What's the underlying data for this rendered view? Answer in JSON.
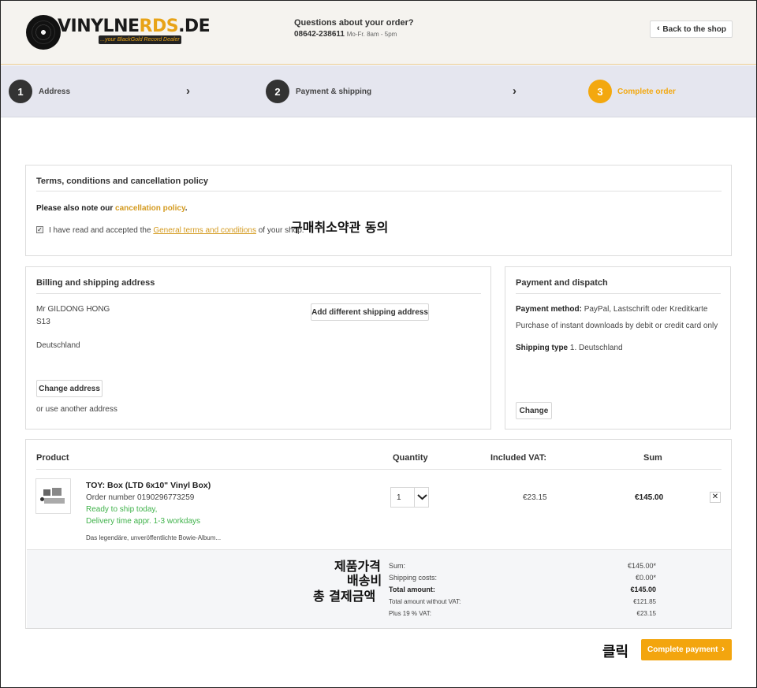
{
  "header": {
    "logo_text_a": "VINYLNE",
    "logo_text_b": "RDS",
    "logo_text_c": ".DE",
    "logo_tagline": "...your BlackGold Record Dealer",
    "question": "Questions about your order?",
    "phone": "08642-238611",
    "hours": "Mo-Fr. 8am - 5pm",
    "back_label": "Back to the shop"
  },
  "steps": [
    {
      "num": "1",
      "label": "Address"
    },
    {
      "num": "2",
      "label": "Payment & shipping"
    },
    {
      "num": "3",
      "label": "Complete order"
    }
  ],
  "terms": {
    "title": "Terms, conditions and cancellation policy",
    "note_prefix": "Please also note our",
    "note_link": "cancellation policy",
    "note_suffix": ".",
    "accept_prefix": "I have read and accepted the",
    "accept_link": "General terms and conditions",
    "accept_suffix": "of your shop.",
    "checked": true
  },
  "billing": {
    "title": "Billing and shipping address",
    "name": "Mr GILDONG HONG",
    "line2": "S13",
    "country": "Deutschland",
    "add_shipping_label": "Add different shipping address",
    "change_label": "Change address",
    "other_link": "or use another address"
  },
  "payment": {
    "title": "Payment and dispatch",
    "method_label": "Payment method:",
    "method_value": "PayPal, Lastschrift oder Kreditkarte",
    "method_note": "Purchase of instant downloads by debit or credit card only",
    "shipping_label": "Shipping type",
    "shipping_value": "1. Deutschland",
    "change_label": "Change"
  },
  "table": {
    "headers": {
      "product": "Product",
      "quantity": "Quantity",
      "vat": "Included VAT:",
      "sum": "Sum"
    },
    "items": [
      {
        "name": "TOY: Box (LTD 6x10\" Vinyl Box)",
        "order_number": "Order number 0190296773259",
        "status1": "Ready to ship today,",
        "status2": "Delivery time appr. 1-3 workdays",
        "description": "Das legendäre, unveröffentlichte Bowie-Album...",
        "quantity": "1",
        "vat": "€23.15",
        "sum": "€145.00",
        "remove": "✕"
      }
    ]
  },
  "summary": {
    "rows": [
      {
        "label": "Sum:",
        "value": "€145.00*"
      },
      {
        "label": "Shipping costs:",
        "value": "€0.00*"
      },
      {
        "label": "Total amount:",
        "value": "€145.00"
      },
      {
        "label": "Total amount without VAT:",
        "value": "€121.85"
      },
      {
        "label": "Plus 19 % VAT:",
        "value": "€23.15"
      }
    ]
  },
  "annotations": {
    "terms": "구매취소약관 동의",
    "product_price": "제품가격",
    "shipping": "배송비",
    "total": "총 결제금액",
    "click": "클릭"
  },
  "complete_payment_label": "Complete payment",
  "colors": {
    "accent": "#f3a50e",
    "link": "#d49a1f",
    "success": "#3fb24a",
    "step_bar": "#e5e6ef"
  }
}
